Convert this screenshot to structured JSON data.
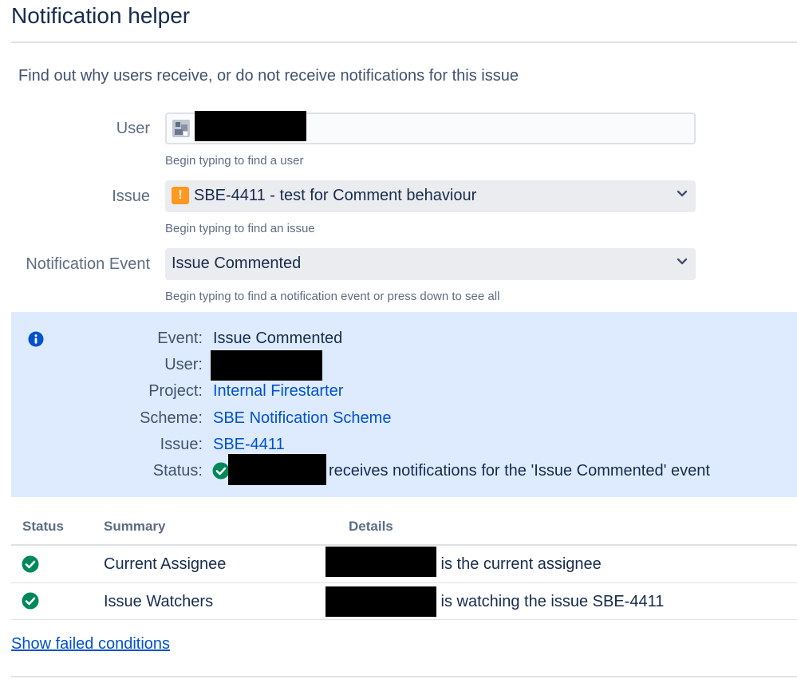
{
  "header": {
    "title": "Notification helper"
  },
  "intro": "Find out why users receive, or do not receive notifications for this issue",
  "form": {
    "user": {
      "label": "User",
      "hint": "Begin typing to find a user"
    },
    "issue": {
      "label": "Issue",
      "value": "SBE-4411 - test for Comment behaviour",
      "hint": "Begin typing to find an issue",
      "icon": "warning-icon"
    },
    "event": {
      "label": "Notification Event",
      "value": "Issue Commented",
      "hint": "Begin typing to find a notification event or press down to see all"
    }
  },
  "info": {
    "event_label": "Event:",
    "event_value": "Issue Commented",
    "user_label": "User:",
    "project_label": "Project:",
    "project_value": "Internal Firestarter",
    "scheme_label": "Scheme:",
    "scheme_value": "SBE Notification Scheme",
    "issue_label": "Issue:",
    "issue_value": "SBE-4411",
    "status_label": "Status:",
    "status_value": "receives notifications for the 'Issue Commented' event"
  },
  "table": {
    "headers": {
      "status": "Status",
      "summary": "Summary",
      "details": "Details"
    },
    "rows": [
      {
        "summary": "Current Assignee",
        "details": "y is the current assignee"
      },
      {
        "summary": "Issue Watchers",
        "details": "y is watching the issue SBE-4411"
      }
    ]
  },
  "show_failed": "Show failed conditions",
  "colors": {
    "accent": "#0052cc",
    "panel": "#deebff",
    "success": "#00875a",
    "warning": "#ff991f"
  }
}
